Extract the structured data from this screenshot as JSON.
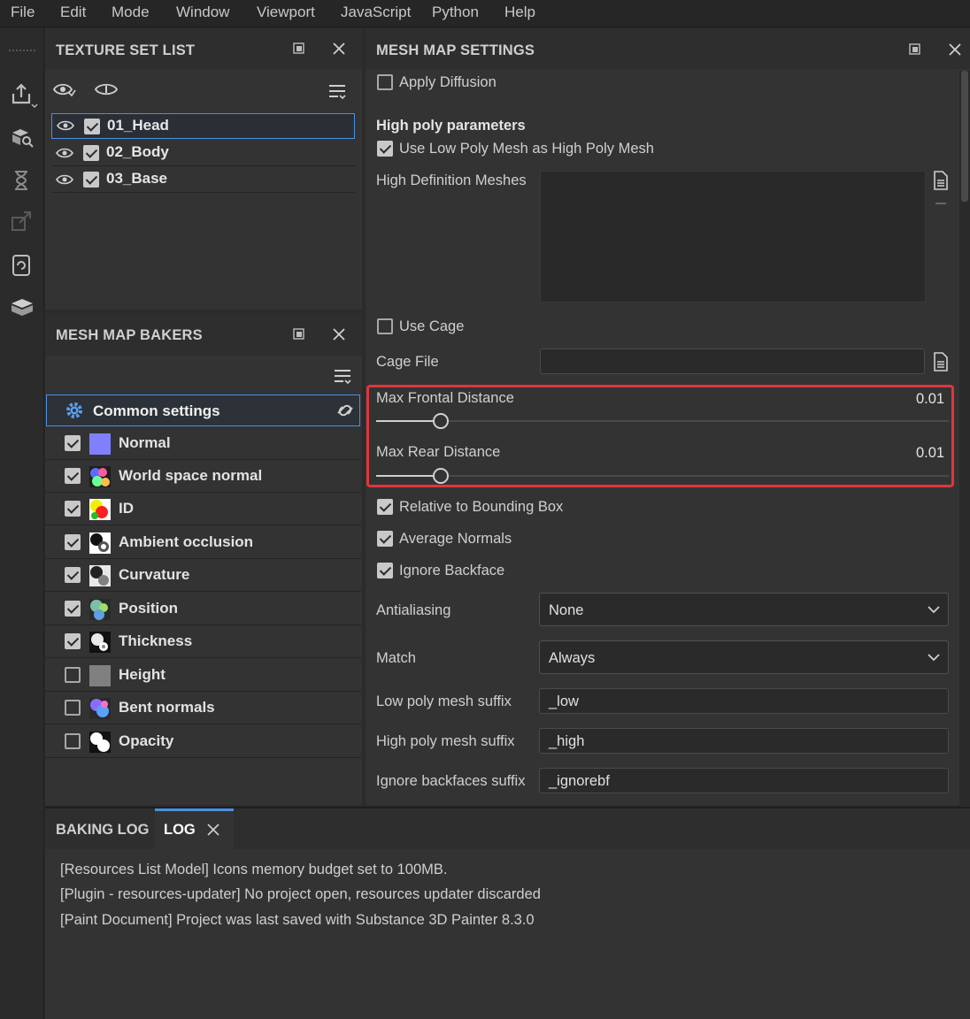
{
  "menu": [
    "File",
    "Edit",
    "Mode",
    "Window",
    "Viewport",
    "JavaScript",
    "Python",
    "Help"
  ],
  "texture_set_list": {
    "title": "TEXTURE SET LIST",
    "items": [
      {
        "label": "01_Head",
        "checked": true,
        "selected": true
      },
      {
        "label": "02_Body",
        "checked": true
      },
      {
        "label": "03_Base",
        "checked": true
      }
    ]
  },
  "bakers": {
    "title": "MESH MAP BAKERS",
    "common": "Common settings",
    "items": [
      {
        "label": "Normal",
        "checked": true,
        "icon": "normal-swatch"
      },
      {
        "label": "World space normal",
        "checked": true,
        "icon": "world-normal-swatch"
      },
      {
        "label": "ID",
        "checked": true,
        "icon": "id-swatch"
      },
      {
        "label": "Ambient occlusion",
        "checked": true,
        "icon": "ao-swatch"
      },
      {
        "label": "Curvature",
        "checked": true,
        "icon": "curvature-swatch"
      },
      {
        "label": "Position",
        "checked": true,
        "icon": "position-swatch"
      },
      {
        "label": "Thickness",
        "checked": true,
        "icon": "thickness-swatch"
      },
      {
        "label": "Height",
        "checked": false,
        "icon": "height-swatch"
      },
      {
        "label": "Bent normals",
        "checked": false,
        "icon": "bent-normals-swatch"
      },
      {
        "label": "Opacity",
        "checked": false,
        "icon": "opacity-swatch"
      }
    ]
  },
  "settings": {
    "title": "MESH MAP SETTINGS",
    "apply_diffusion": "Apply Diffusion",
    "high_poly_params": "High poly parameters",
    "use_low_as_high": "Use Low Poly Mesh as High Poly Mesh",
    "high_def_meshes": "High Definition Meshes",
    "use_cage": "Use Cage",
    "cage_file": "Cage File",
    "max_frontal": {
      "label": "Max Frontal Distance",
      "value": "0.01",
      "fraction": 0.01
    },
    "max_rear": {
      "label": "Max Rear Distance",
      "value": "0.01",
      "fraction": 0.01
    },
    "relative_bbox": "Relative to Bounding Box",
    "average_normals": "Average Normals",
    "ignore_backface": "Ignore Backface",
    "antialiasing": {
      "label": "Antialiasing",
      "value": "None"
    },
    "match": {
      "label": "Match",
      "value": "Always"
    },
    "low_suffix": {
      "label": "Low poly mesh suffix",
      "value": "_low"
    },
    "high_suffix": {
      "label": "High poly mesh suffix",
      "value": "_high"
    },
    "ignore_suffix": {
      "label": "Ignore backfaces suffix",
      "value": "_ignorebf"
    }
  },
  "log": {
    "tab_baking": "BAKING LOG",
    "tab_log": "LOG",
    "lines": [
      "[Resources List Model] Icons memory budget set to 100MB.",
      "[Plugin - resources-updater] No project open, resources updater discarded",
      "[Paint Document] Project was last saved with Substance 3D Painter 8.3.0"
    ]
  },
  "colors": {
    "accent": "#4a90e2",
    "highlight": "#e0363c"
  }
}
